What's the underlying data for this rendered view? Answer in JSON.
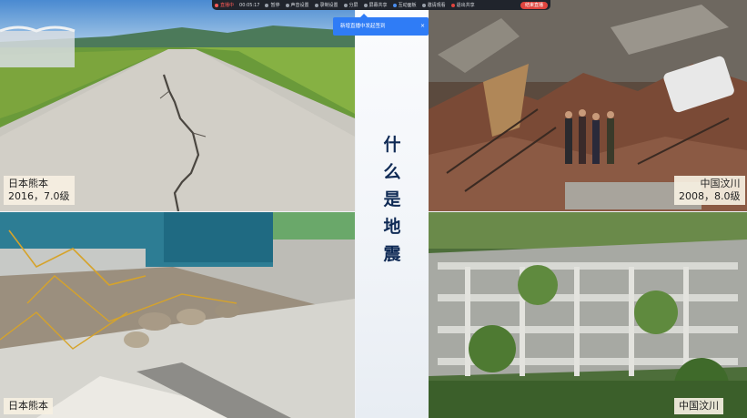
{
  "toolbar": {
    "live_label": "直播中",
    "timer": "00:05:17",
    "items": [
      "暂停",
      "声音设置",
      "录制设置",
      "分屏",
      "屏幕共享",
      "互动面板",
      "邀请观看",
      "退出共享"
    ],
    "end_label": "结束直播"
  },
  "tooltip": {
    "text": "新增直播中发起签到",
    "close": "×"
  },
  "title_chars": [
    "什",
    "么",
    "是",
    "地",
    "震"
  ],
  "photos": {
    "top_left": {
      "caption_line1": "日本熊本",
      "caption_line2": "2016，7.0级"
    },
    "top_right": {
      "caption_line1": "中国汶川",
      "caption_line2": "2008，8.0级"
    },
    "bottom_left": {
      "caption_line1": "日本熊本"
    },
    "bottom_right": {
      "caption_line1": "中国汶川"
    }
  },
  "colors": {
    "title": "#0f2a55",
    "tooltip": "#2f7cf6",
    "end_button": "#e0443e",
    "toolbar": "#20242c"
  }
}
